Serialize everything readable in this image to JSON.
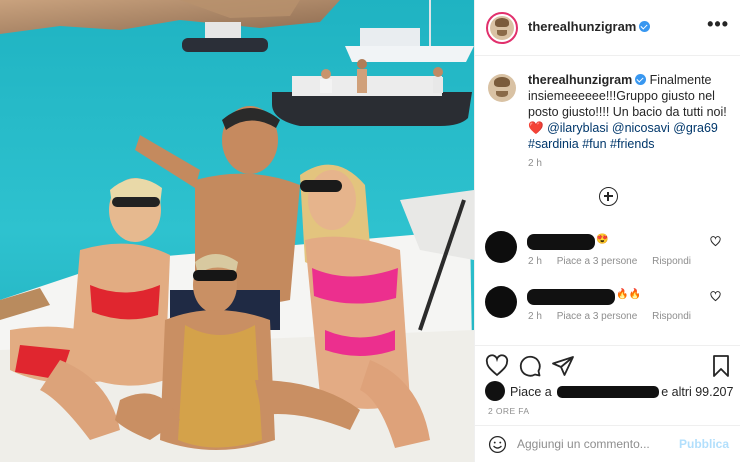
{
  "post": {
    "username": "therealhunzigram",
    "verified": true,
    "more_icon": "more-horizontal-icon"
  },
  "caption": {
    "username": "therealhunzigram",
    "text": "Finalmente insiemeeeeee!!!Gruppo giusto nel posto giusto!!!! Un bacio da tutti noi!",
    "heart": "❤️",
    "mentions": [
      "@ilaryblasi",
      "@nicosavi",
      "@gra69"
    ],
    "hashtags": [
      "#sardinia",
      "#fun",
      "#friends"
    ],
    "time": "2 h"
  },
  "comments": [
    {
      "emoji": "😍",
      "time": "2 h",
      "likes": "Piace a 3 persone",
      "reply": "Rispondi"
    },
    {
      "emoji": "🔥🔥",
      "time": "2 h",
      "likes": "Piace a 3 persone",
      "reply": "Rispondi"
    }
  ],
  "likes": {
    "prefix": "Piace a",
    "suffix": "e altri 99.207"
  },
  "posted_ago": "2 ORE FA",
  "add_comment": {
    "placeholder": "Aggiungi un commento...",
    "publish_label": "Pubblica"
  },
  "colors": {
    "verified": "#3897f0",
    "link": "#00376b",
    "publish_disabled": "#b2dffc",
    "secondary_text": "#8e8e8e",
    "heart_red": "#ed4956"
  },
  "icons": [
    "heart-icon",
    "comment-icon",
    "share-icon",
    "bookmark-icon",
    "emoji-icon",
    "load-more-comments-icon"
  ]
}
